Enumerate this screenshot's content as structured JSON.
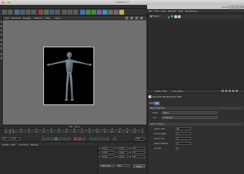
{
  "window": {
    "title": "Untitled 2 *",
    "traffic_colors": [
      "#ee5f57",
      "#f5bd4f",
      "#5fc453"
    ]
  },
  "main_menu": [
    "File",
    "Edit",
    "Create",
    "Select",
    "Tools",
    "Mesh",
    "Snap",
    "Animate",
    "Simulate",
    "Render",
    "Sculpt",
    "MoGraph",
    "Character",
    "Plugins",
    "Script",
    "Window",
    "Help"
  ],
  "layout": {
    "label": "Layout:",
    "value": "1280x768 Stand"
  },
  "viewport": {
    "menu": [
      "View",
      "Cameras",
      "Display",
      "Options",
      "Filter",
      "Panel"
    ],
    "fps_text": "FPS : 233.0"
  },
  "timeline": {
    "tick_labels": [
      "0",
      "5",
      "10",
      "15",
      "20",
      "25",
      "30",
      "35",
      "40",
      "45",
      "50",
      "55",
      "60",
      "65",
      "70",
      "75",
      "80",
      "85",
      "90"
    ],
    "start_field": "0 F",
    "end_field": "90 F",
    "current_field": "0 F"
  },
  "material_manager": {
    "menu": [
      "Create",
      "Edit",
      "Function",
      "Texture"
    ]
  },
  "coordinates": {
    "rows": [
      {
        "axis": "X",
        "pos": "0 cm",
        "size": "0 cm",
        "rot_label": "H",
        "rot": "0°"
      },
      {
        "axis": "Y",
        "pos": "0 cm",
        "size": "0 cm",
        "rot_label": "P",
        "rot": "0°"
      },
      {
        "axis": "Z",
        "pos": "0 cm",
        "size": "0 cm",
        "rot_label": "B",
        "rot": "0°"
      }
    ],
    "mode": "Object (Rel)",
    "size_mode": "Size",
    "apply": "Apply"
  },
  "object_manager": {
    "menu": [
      "File",
      "Edit",
      "View",
      "Objects",
      "Tags",
      "Bookmarks"
    ],
    "object_name": "Figure"
  },
  "attribute_manager": {
    "menu": [
      "Mode",
      "Edit",
      "User Data"
    ],
    "title": "Dynamic IK6 [Dynamic IK6]",
    "tabs": [
      "Basic",
      "Tag"
    ],
    "active_tab": "Tag",
    "section_tag": "Tag Properties",
    "props": [
      {
        "label": "Mode",
        "value": "Object"
      },
      {
        "label": "Chn",
        "value": "On Window"
      }
    ],
    "section_add": "Add to Frame",
    "add_fields": [
      {
        "label": "Add to Left",
        "value": "20"
      },
      {
        "label": "Add to Right",
        "value": "0"
      },
      {
        "label": "Add to Top",
        "value": "0"
      },
      {
        "label": "Add to Bottom",
        "value": "0"
      }
    ],
    "link_all": "Link All"
  },
  "colors": {
    "accent": "#26a06f",
    "active_tab_bg": "#5b6f8f"
  }
}
